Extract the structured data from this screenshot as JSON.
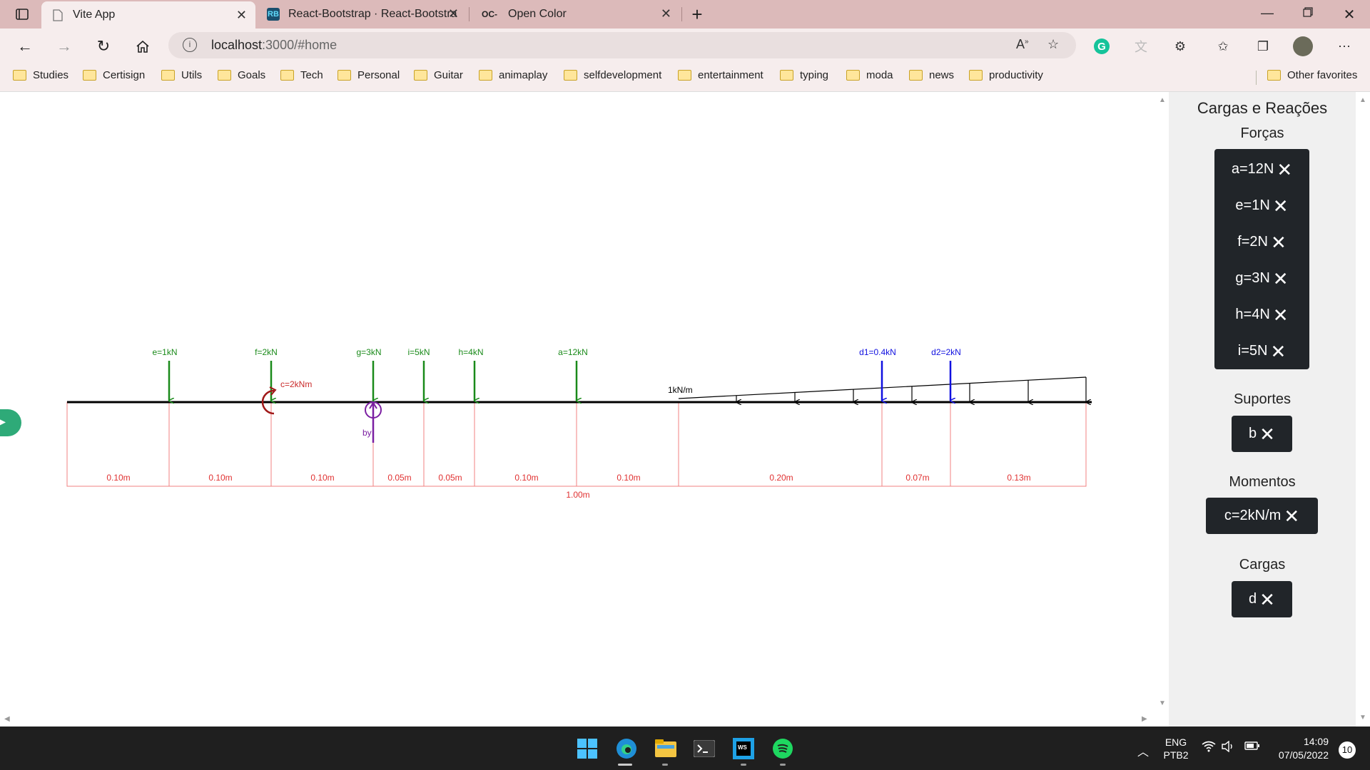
{
  "tabs": [
    {
      "title": "Vite App"
    },
    {
      "title": "React-Bootstrap · React-Bootstra"
    },
    {
      "title": "Open Color",
      "icon": "OC-"
    }
  ],
  "address": {
    "host": "localhost",
    "rest": ":3000/#home"
  },
  "bookmarks": [
    "Studies",
    "Certisign",
    "Utils",
    "Goals",
    "Tech",
    "Personal",
    "Guitar",
    "animaplay",
    "selfdevelopment",
    "entertainment",
    "typing",
    "moda",
    "news",
    "productivity"
  ],
  "other_favorites": "Other favorites",
  "beam": {
    "loads": [
      {
        "label": "e=1kN",
        "color": "#1a8a1a"
      },
      {
        "label": "f=2kN",
        "color": "#1a8a1a"
      },
      {
        "label": "g=3kN",
        "color": "#1a8a1a"
      },
      {
        "label": "i=5kN",
        "color": "#1a8a1a"
      },
      {
        "label": "h=4kN",
        "color": "#1a8a1a"
      },
      {
        "label": "a=12kN",
        "color": "#1a8a1a"
      },
      {
        "label": "d1=0.4kN",
        "color": "#1010e0"
      },
      {
        "label": "d2=2kN",
        "color": "#1010e0"
      }
    ],
    "moment_label": "c=2kNm",
    "support_label": "by",
    "distributed_label": "1kN/m",
    "segments": [
      "0.10m",
      "0.10m",
      "0.10m",
      "0.05m",
      "0.05m",
      "0.10m",
      "0.10m",
      "0.20m",
      "0.07m",
      "0.13m"
    ],
    "total": "1.00m"
  },
  "sidebar": {
    "title": "Cargas e Reações",
    "forces_title": "Forças",
    "forces": [
      "a=12N",
      "e=1N",
      "f=2N",
      "g=3N",
      "h=4N",
      "i=5N"
    ],
    "supports_title": "Suportes",
    "supports": [
      "b"
    ],
    "moments_title": "Momentos",
    "moments": [
      "c=2kN/m"
    ],
    "loads_title": "Cargas",
    "loads": [
      "d"
    ]
  },
  "tray": {
    "lang1": "ENG",
    "lang2": "PTB2",
    "time": "14:09",
    "date": "07/05/2022",
    "notifications": "10"
  },
  "colors": {
    "titlebar": "#dcbaba",
    "tab_active": "#f6eded",
    "panel": "#212529",
    "force": "#1a8a1a",
    "load": "#1010e0",
    "dimension": "#e03131"
  }
}
